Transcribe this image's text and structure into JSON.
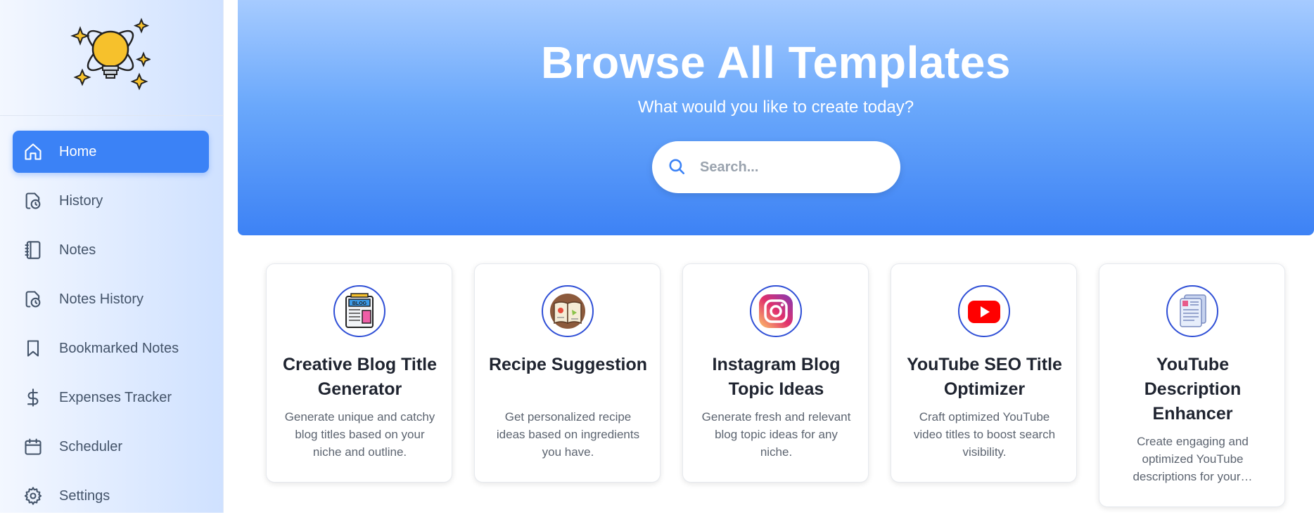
{
  "sidebar": {
    "logo_name": "lightbulb-logo",
    "items": [
      {
        "label": "Home",
        "icon": "home-icon",
        "active": true
      },
      {
        "label": "History",
        "icon": "history-icon"
      },
      {
        "label": "Notes",
        "icon": "notebook-icon"
      },
      {
        "label": "Notes History",
        "icon": "notes-history-icon"
      },
      {
        "label": "Bookmarked Notes",
        "icon": "bookmark-icon"
      },
      {
        "label": "Expenses Tracker",
        "icon": "dollar-icon"
      },
      {
        "label": "Scheduler",
        "icon": "calendar-icon"
      },
      {
        "label": "Settings",
        "icon": "gear-icon"
      }
    ]
  },
  "hero": {
    "title": "Browse All Templates",
    "subtitle": "What would you like to create today?"
  },
  "search": {
    "placeholder": "Search..."
  },
  "cards": [
    {
      "title": "Creative Blog Title Generator",
      "description": "Generate unique and catchy blog titles based on your niche and outline.",
      "icon": "blog-icon"
    },
    {
      "title": "Recipe Suggestion",
      "description": "Get personalized recipe ideas based on ingredients you have.",
      "icon": "recipe-book-icon"
    },
    {
      "title": "Instagram Blog Topic Ideas",
      "description": "Generate fresh and relevant blog topic ideas for any niche.",
      "icon": "instagram-icon"
    },
    {
      "title": "YouTube SEO Title Optimizer",
      "description": "Craft optimized YouTube video titles to boost search visibility.",
      "icon": "youtube-icon"
    },
    {
      "title": "YouTube Description Enhancer",
      "description": "Create engaging and optimized YouTube descriptions for your…",
      "icon": "document-icon"
    }
  ],
  "colors": {
    "accent": "#3b82f6",
    "hero_top": "#a6cbff",
    "hero_bottom": "#3d82f5"
  }
}
